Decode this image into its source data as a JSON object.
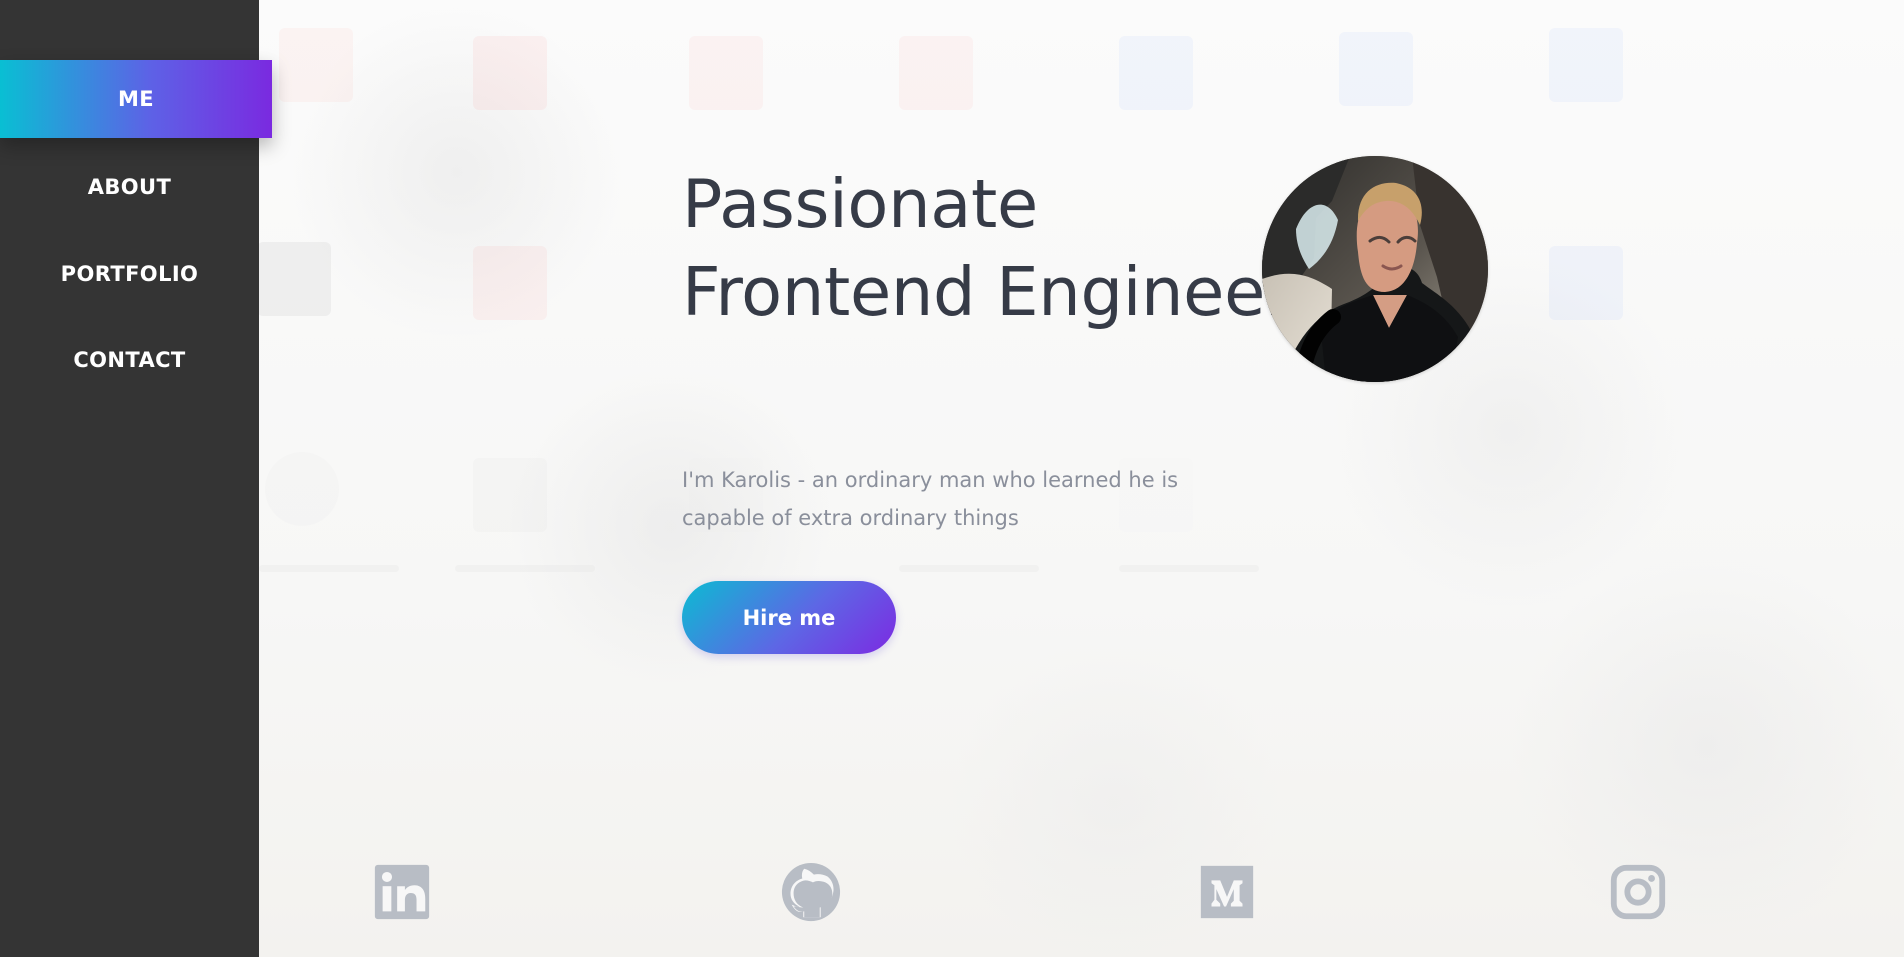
{
  "navigation": {
    "items": [
      {
        "label": "ME",
        "active": true
      },
      {
        "label": "ABOUT",
        "active": false
      },
      {
        "label": "PORTFOLIO",
        "active": false
      },
      {
        "label": "CONTACT",
        "active": false
      }
    ]
  },
  "hero": {
    "headline_line_1": "Passionate",
    "headline_line_2": "Frontend Engineer",
    "intro_text": "I'm Karolis - an ordinary man who learned he is capable of extra ordinary things",
    "hire_button_label": "Hire me"
  },
  "social_links": [
    {
      "icon": "linkedin-icon"
    },
    {
      "icon": "github-icon"
    },
    {
      "icon": "medium-icon"
    },
    {
      "icon": "instagram-icon"
    }
  ],
  "colors": {
    "sidebar_background": "#343434",
    "primary_gradient_start": "#09bfd3",
    "primary_gradient_mid": "#5d62e6",
    "primary_gradient_end": "#7a2ae0",
    "heading_text": "#363b47",
    "body_text": "#8a8f9b",
    "social_icon": "#b8bdc5"
  }
}
